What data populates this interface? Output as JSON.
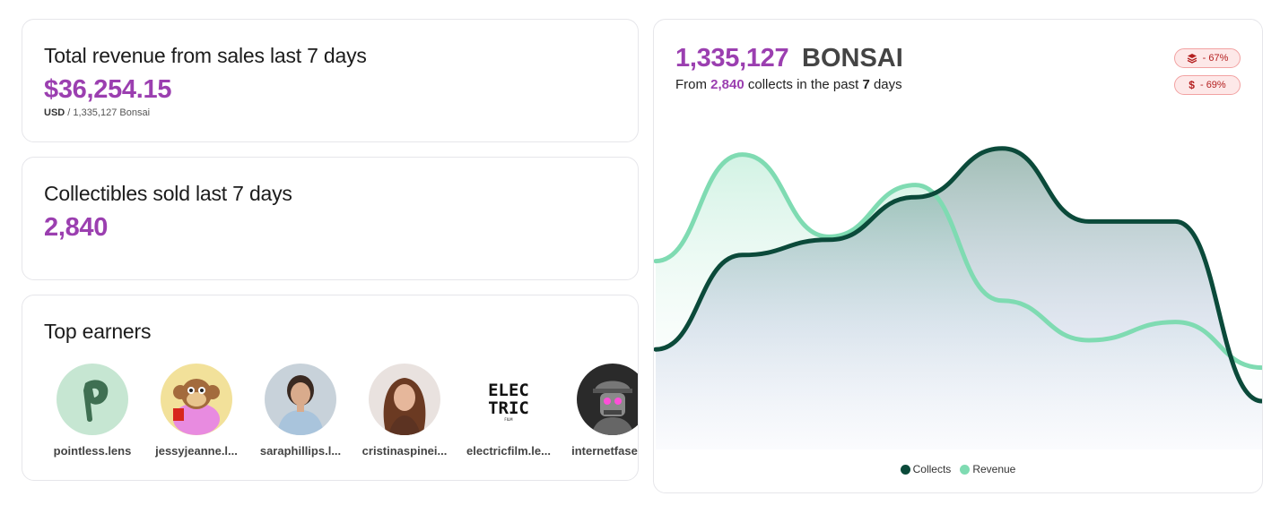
{
  "revenue_card": {
    "title": "Total revenue from sales last 7 days",
    "amount": "$36,254.15",
    "currency": "USD",
    "sub_detail": " / 1,335,127 Bonsai"
  },
  "collect_card": {
    "title": "Collectibles sold last 7 days",
    "count": "2,840"
  },
  "earners_card": {
    "title": "Top earners",
    "earners": [
      {
        "name": "pointless.lens",
        "avatar": "letter-p-avatar"
      },
      {
        "name": "jessyjeanne.l...",
        "avatar": "monkey-avatar"
      },
      {
        "name": "saraphillips.l...",
        "avatar": "person-avatar"
      },
      {
        "name": "cristinaspinei...",
        "avatar": "person-avatar"
      },
      {
        "name": "electricfilm.le...",
        "avatar": "electric-film-logo",
        "logo_text": [
          "ELEC",
          "TRIC",
          "FILM"
        ]
      },
      {
        "name": "internetfase.l...",
        "avatar": "robot-avatar"
      }
    ]
  },
  "chart_card": {
    "total": "1,335,127",
    "unit": "BONSAI",
    "sub_prefix": "From ",
    "sub_collects": "2,840",
    "sub_middle": " collects in the past ",
    "sub_days": "7",
    "sub_suffix": " days",
    "badges": [
      {
        "icon": "layers-icon",
        "text": "- 67%"
      },
      {
        "icon": "dollar-icon",
        "symbol": "$",
        "text": "- 69%"
      }
    ],
    "legend": [
      {
        "label": "Collects",
        "color": "#0b4a3a"
      },
      {
        "label": "Revenue",
        "color": "#7fdbb2"
      }
    ]
  },
  "chart_data": {
    "type": "area",
    "title": "",
    "xlabel": "",
    "ylabel": "",
    "x": [
      0,
      1,
      2,
      3,
      4,
      5,
      6,
      7
    ],
    "grid": false,
    "legend_position": "bottom-center",
    "series": [
      {
        "name": "Collects",
        "color": "#0b4a3a",
        "values": [
          0.27,
          0.58,
          0.63,
          0.77,
          0.93,
          0.69,
          0.69,
          0.1
        ]
      },
      {
        "name": "Revenue",
        "color": "#7fdbb2",
        "values": [
          0.56,
          0.91,
          0.64,
          0.81,
          0.43,
          0.3,
          0.36,
          0.21
        ]
      }
    ]
  }
}
